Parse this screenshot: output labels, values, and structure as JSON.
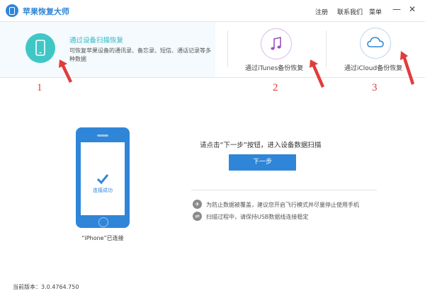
{
  "app": {
    "title": "苹果恢复大师"
  },
  "titlebar": {
    "links": [
      "注册",
      "联系我们",
      "菜单"
    ],
    "minimize": "—",
    "close": "✕"
  },
  "modes": [
    {
      "title": "通过设备扫描恢复",
      "desc": "可恢复苹果设备的通讯录、备忘录、短信、通话记录等多种数据",
      "icon": "phone-icon"
    },
    {
      "label": "通过iTunes备份恢复",
      "icon": "music-note-icon"
    },
    {
      "label": "通过iCloud备份恢复",
      "icon": "cloud-icon"
    }
  ],
  "annotations": [
    "1",
    "2",
    "3"
  ],
  "device": {
    "connected_text": "连接成功",
    "caption": "“iPhone”已连接"
  },
  "main": {
    "instruction": "请点击“下一步”按钮，进入设备数据扫描",
    "next_button": "下一步",
    "tips": [
      {
        "icon": "airplane-icon",
        "text": "为防止数据被覆盖，建议您开启飞行模式并尽量停止使用手机"
      },
      {
        "icon": "usb-icon",
        "text": "扫描过程中，请保持USB数据线连接稳定"
      }
    ]
  },
  "footer": {
    "version": "当前版本：3.0.4764.750"
  },
  "colors": {
    "accent": "#2f86d8",
    "teal": "#3fc7c7",
    "annotation": "#e23b3b"
  }
}
